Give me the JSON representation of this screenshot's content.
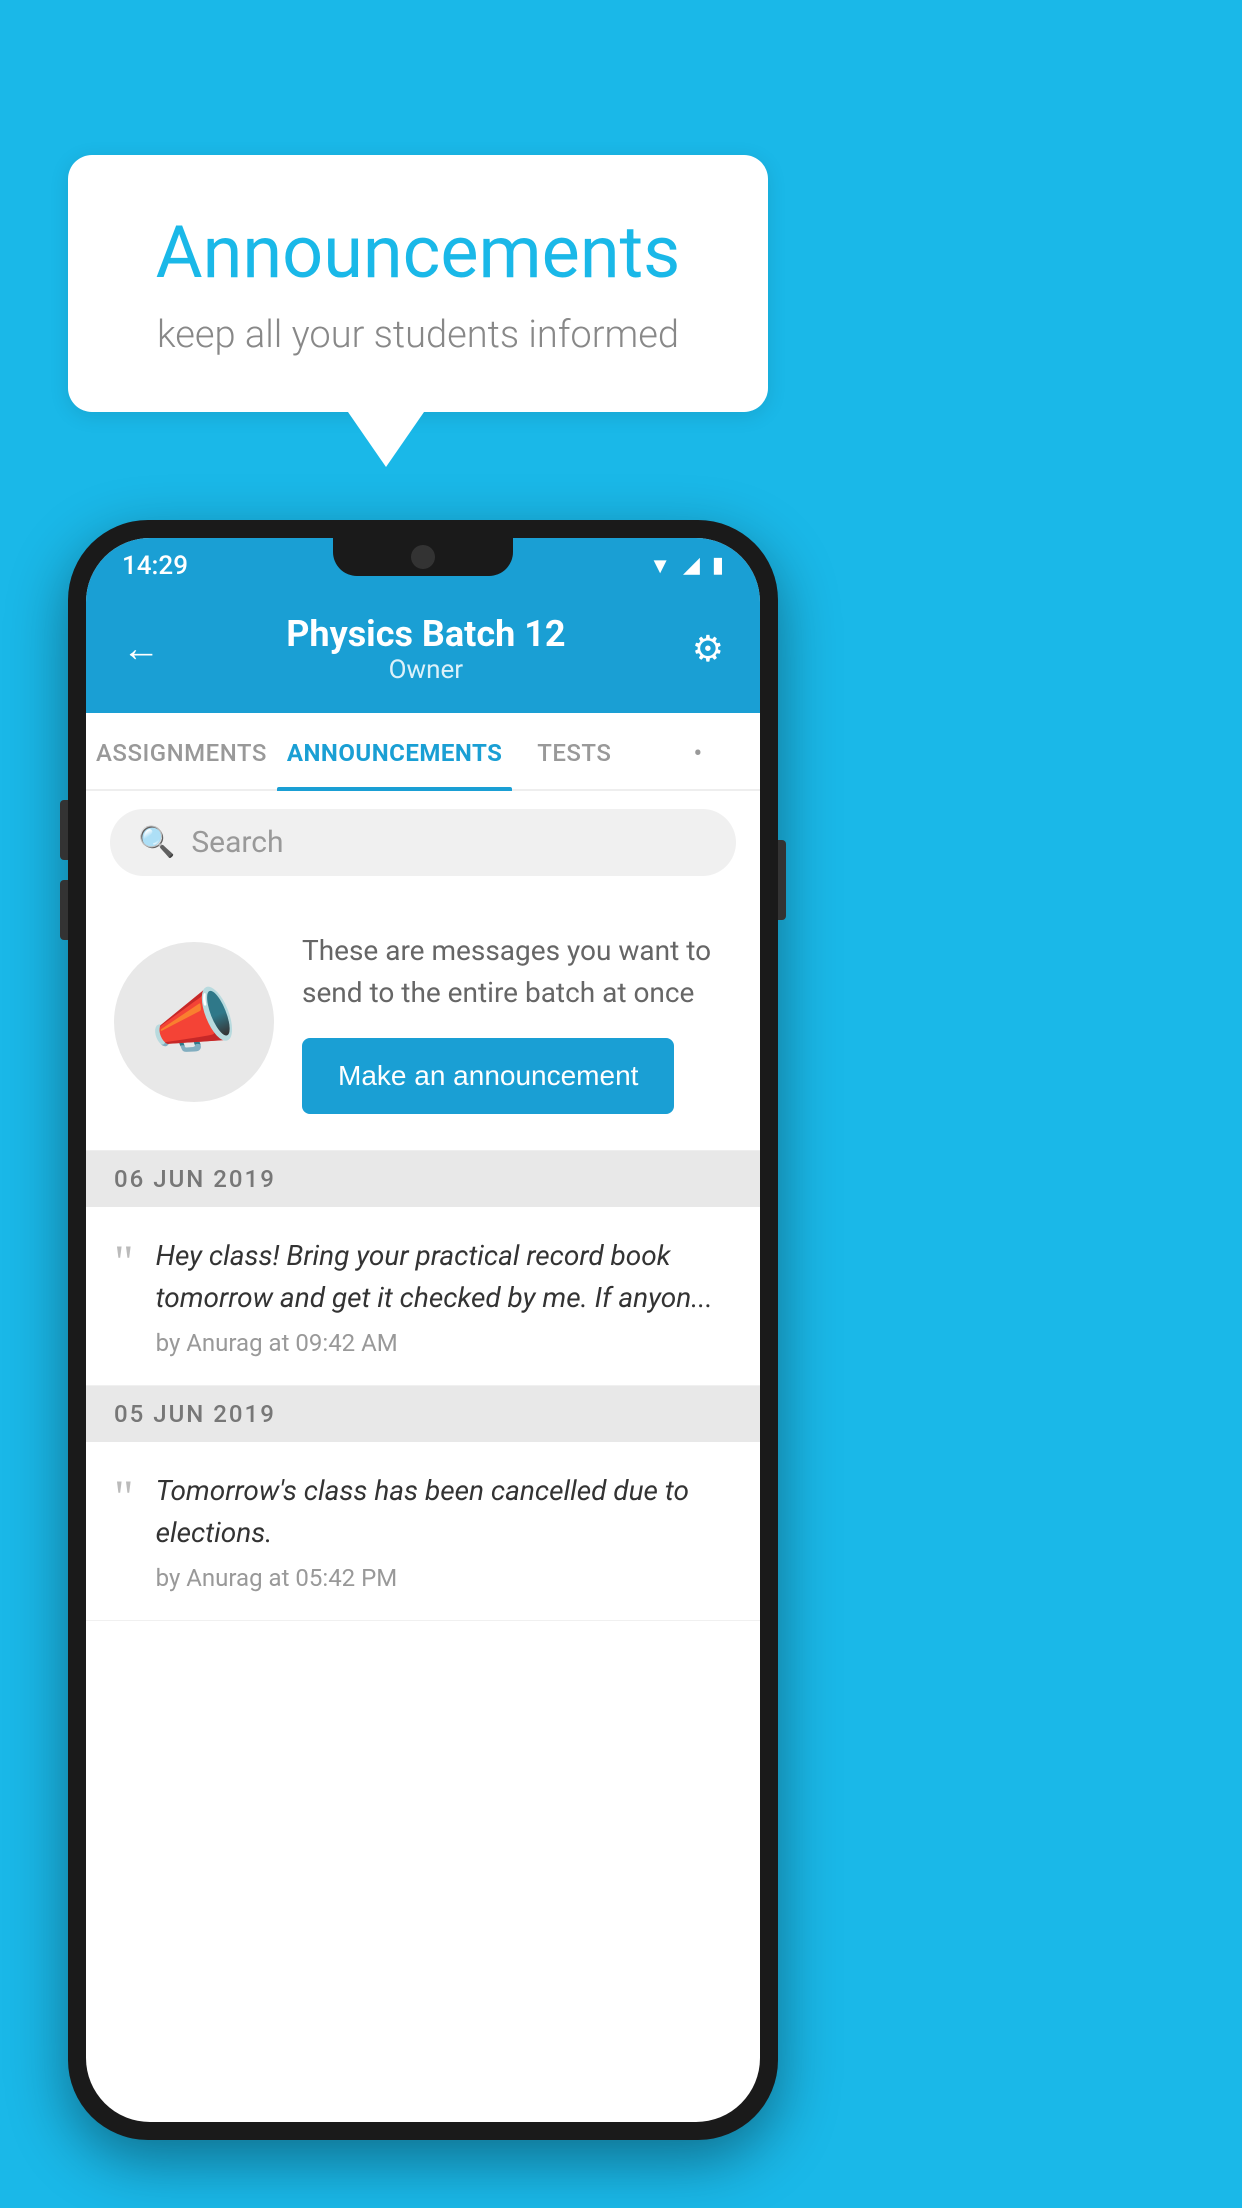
{
  "background_color": "#1ab8e8",
  "speech_bubble": {
    "title": "Announcements",
    "subtitle": "keep all your students informed"
  },
  "phone": {
    "status_bar": {
      "time": "14:29",
      "icons": [
        "wifi",
        "signal",
        "battery"
      ]
    },
    "header": {
      "title": "Physics Batch 12",
      "subtitle": "Owner",
      "back_label": "←",
      "gear_label": "⚙"
    },
    "tabs": [
      {
        "label": "ASSIGNMENTS",
        "active": false
      },
      {
        "label": "ANNOUNCEMENTS",
        "active": true
      },
      {
        "label": "TESTS",
        "active": false
      },
      {
        "label": "•",
        "active": false
      }
    ],
    "search": {
      "placeholder": "Search"
    },
    "promo": {
      "icon": "📣",
      "text": "These are messages you want to send to the entire batch at once",
      "button_label": "Make an announcement"
    },
    "announcements": [
      {
        "date": "06  JUN  2019",
        "message": "Hey class! Bring your practical record book tomorrow and get it checked by me. If anyon...",
        "meta": "by Anurag at 09:42 AM"
      },
      {
        "date": "05  JUN  2019",
        "message": "Tomorrow's class has been cancelled due to elections.",
        "meta": "by Anurag at 05:42 PM"
      }
    ]
  }
}
